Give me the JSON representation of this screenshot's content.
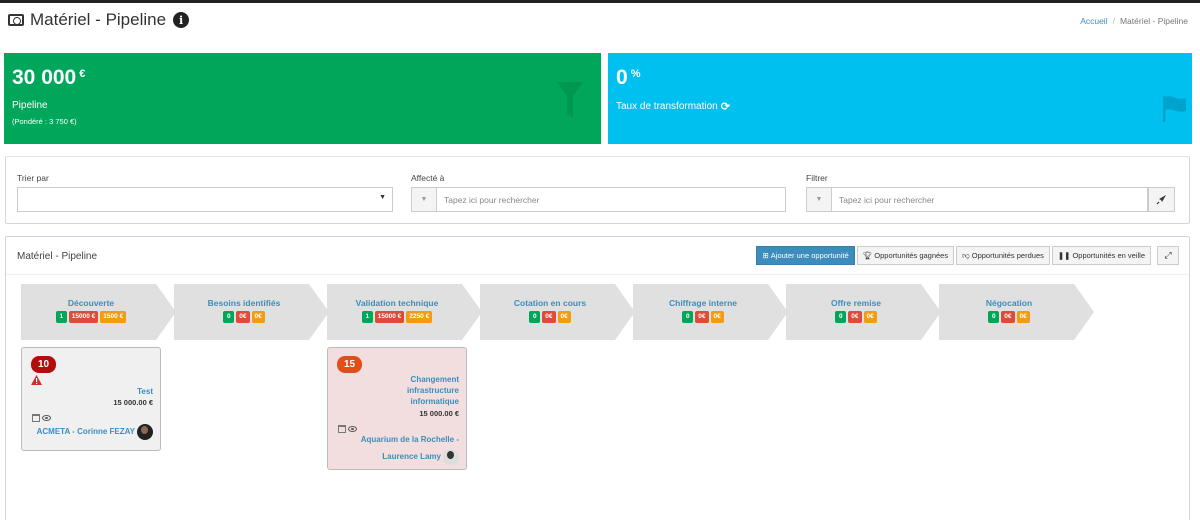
{
  "header": {
    "title": "Matériel - Pipeline",
    "breadcrumb": {
      "home": "Accueil",
      "separator": "/",
      "current": "Matériel - Pipeline"
    }
  },
  "stats": {
    "pipeline": {
      "value": "30 000",
      "unit": "€",
      "label": "Pipeline",
      "sub": "(Pondéré : 3 750 €)",
      "color": "#00a65a"
    },
    "transformation": {
      "value": "0",
      "unit": "%",
      "label": "Taux de transformation",
      "color": "#00c0ef"
    }
  },
  "filters": {
    "sort_label": "Trier par",
    "sort_value": "",
    "assigned_label": "Affecté à",
    "assigned_placeholder": "Tapez ici pour rechercher",
    "filter_label": "Filtrer",
    "filter_placeholder": "Tapez ici pour rechercher"
  },
  "board": {
    "title": "Matériel - Pipeline",
    "buttons": {
      "add": "Ajouter une opportunité",
      "won": "Opportunités gagnées",
      "lost": "Opportunités perdues",
      "standby": "Opportunités en veille"
    },
    "stages": [
      {
        "name": "Découverte",
        "count": "1",
        "amount": "15000 €",
        "weighted": "1500 €"
      },
      {
        "name": "Besoins identifiés",
        "count": "0",
        "amount": "0€",
        "weighted": "0€"
      },
      {
        "name": "Validation technique",
        "count": "1",
        "amount": "15000 €",
        "weighted": "2250 €"
      },
      {
        "name": "Cotation en cours",
        "count": "0",
        "amount": "0€",
        "weighted": "0€"
      },
      {
        "name": "Chiffrage interne",
        "count": "0",
        "amount": "0€",
        "weighted": "0€"
      },
      {
        "name": "Offre remise",
        "count": "0",
        "amount": "0€",
        "weighted": "0€"
      },
      {
        "name": "Négocation",
        "count": "0",
        "amount": "0€",
        "weighted": "0€"
      }
    ],
    "cards": [
      {
        "priority": "10",
        "title": "Test",
        "amount": "15 000.00 €",
        "client": "ACMETA - Corinne FEZAY"
      },
      {
        "priority": "15",
        "title_lines": [
          "Changement",
          "infrastructure",
          "informatique"
        ],
        "amount": "15 000.00 €",
        "client_lines": [
          "Aquarium de la Rochelle -",
          "Laurence Lamy"
        ]
      }
    ]
  },
  "colors": {
    "primary": "#3c8dbc",
    "green": "#00a65a",
    "red": "#dd4b39",
    "orange": "#f39c12",
    "aqua": "#00c0ef"
  }
}
